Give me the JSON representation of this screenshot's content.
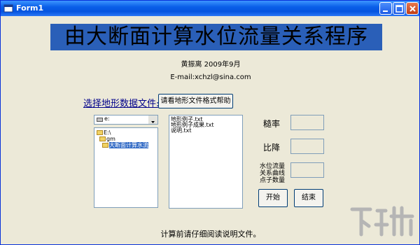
{
  "window": {
    "title": "Form1"
  },
  "banner": {
    "title": "由大断面计算水位流量关系程序"
  },
  "author": {
    "line1": "黄振离   2009年9月",
    "email": "E-mail:xchzl@sina.com"
  },
  "file_picker": {
    "label": "选择地形数据文件:",
    "help_button": "请看地形文件格式帮助",
    "drive": "e:",
    "dirs": [
      "E:\\",
      "gm",
      "大断面计算水流"
    ],
    "files": [
      "地形例子.txt",
      "地形例子成果.txt",
      "说明.txt"
    ]
  },
  "params": {
    "roughness_label": "糙率",
    "slope_label": "比降",
    "points_label_1": "水位流量",
    "points_label_2": "关系曲线",
    "points_label_3": "点子数量",
    "start_button": "开始",
    "end_button": "结束"
  },
  "footer": {
    "note": "计算前请仔细阅读说明文件。"
  },
  "watermark": {
    "text": "下载吧"
  },
  "colors": {
    "banner": "#2a5fb8",
    "titlebar": "#0a5fe8",
    "selection": "#316ac5"
  }
}
